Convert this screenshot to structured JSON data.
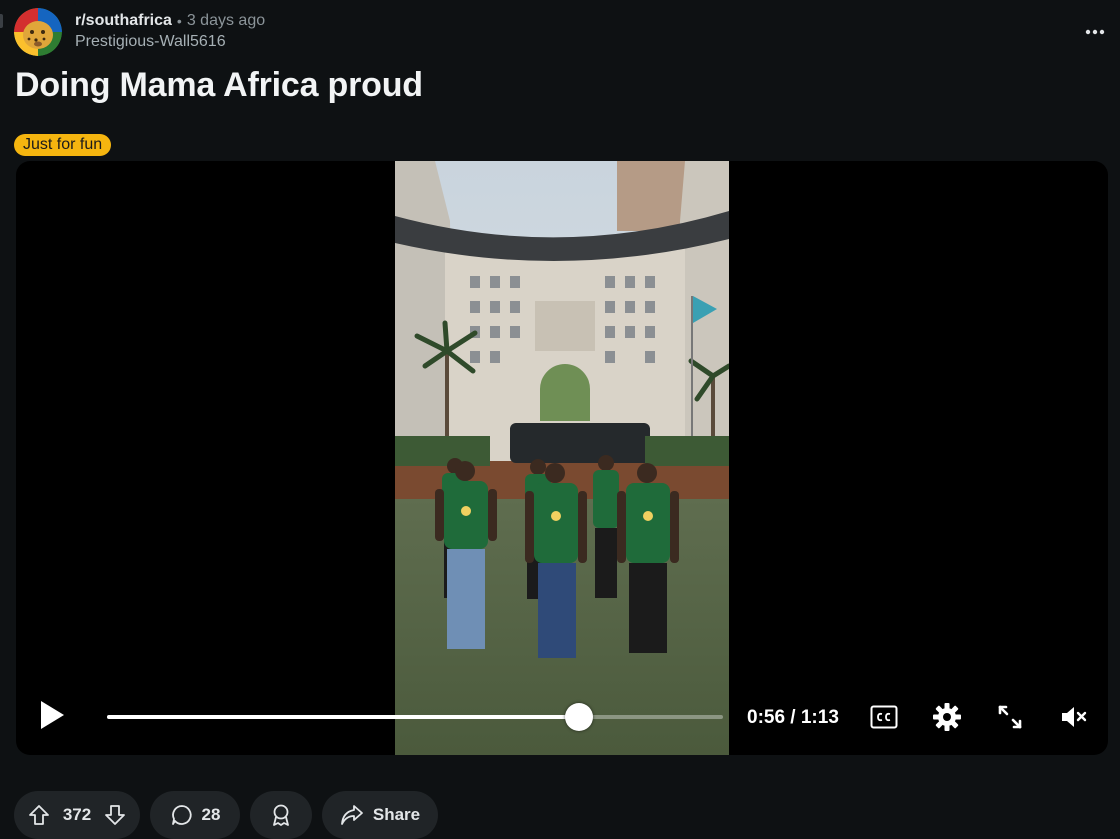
{
  "post": {
    "subreddit": "r/southafrica",
    "separator": "•",
    "time_ago": "3 days ago",
    "author": "Prestigious-Wall5616",
    "title": "Doing Mama Africa proud",
    "flair": "Just for fun"
  },
  "video": {
    "current_time": "0:56",
    "duration": "1:13",
    "time_display": "0:56 / 1:13",
    "progress_fraction": 0.767,
    "muted": true
  },
  "actions": {
    "upvotes": "372",
    "comments": "28",
    "share_label": "Share"
  },
  "colors": {
    "background": "#0e1113",
    "flair_bg": "#f5b50f",
    "pill_bg": "#202427",
    "jersey_green": "#1f6b3a"
  },
  "icons": {
    "more": "more-options-icon",
    "play": "play-icon",
    "captions": "closed-captions-icon",
    "settings": "gear-icon",
    "fullscreen": "fullscreen-icon",
    "mute": "muted-speaker-icon",
    "upvote": "upvote-arrow-icon",
    "downvote": "downvote-arrow-icon",
    "comment": "comment-bubble-icon",
    "award": "award-icon",
    "share": "share-arrow-icon"
  }
}
